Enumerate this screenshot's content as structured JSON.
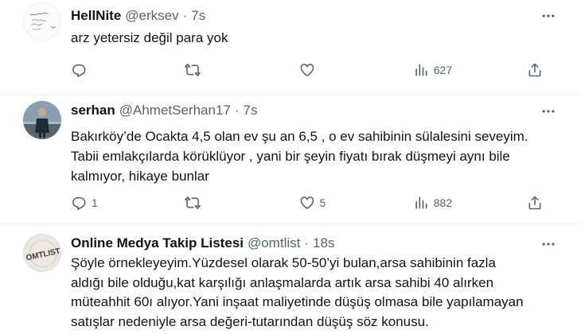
{
  "tweets": [
    {
      "name": "HellNite",
      "handle": "@erksev",
      "separator": "·",
      "time": "7s",
      "lines": [
        "arz yetersiz değil para yok"
      ],
      "counts": {
        "reply": "",
        "retweet": "",
        "like": "",
        "views": "627"
      }
    },
    {
      "name": "serhan",
      "handle": "@AhmetSerhan17",
      "separator": "·",
      "time": "7s",
      "lines": [
        "Bakırköy’de Ocakta 4,5 olan ev şu an 6,5 , o ev sahibinin sülalesini seveyim.",
        "Tabii emlakçılarda körüklüyor , yani bir şeyin fiyatı bırak düşmeyi aynı bile",
        "kalmıyor, hikaye bunlar"
      ],
      "counts": {
        "reply": "1",
        "retweet": "",
        "like": "5",
        "views": "882"
      }
    },
    {
      "name": "Online Medya Takip Listesi",
      "handle": "@omtlist",
      "separator": "·",
      "time": "18s",
      "avatar_text": "OMTLIST",
      "lines": [
        "Şöyle örnekleyeyim.Yüzdesel olarak 50-50’yi bulan,arsa sahibinin fazla",
        "aldığı bile olduğu,kat karşılığı anlaşmalarda artık arsa sahibi 40 alırken",
        "müteahhit 60ı alıyor.Yani inşaat maliyetinde düşüş olmasa bile yapılamayan",
        "satışlar nedeniyle arsa değeri-tutarından düşüş söz konusu."
      ]
    }
  ],
  "icons": {
    "more": "more-horizontal-icon",
    "reply": "reply-icon",
    "retweet": "retweet-icon",
    "like": "heart-icon",
    "views": "analytics-icon",
    "share": "share-icon"
  },
  "colors": {
    "text": "#0f1419",
    "muted": "#536471",
    "divider": "#eff3f4"
  }
}
